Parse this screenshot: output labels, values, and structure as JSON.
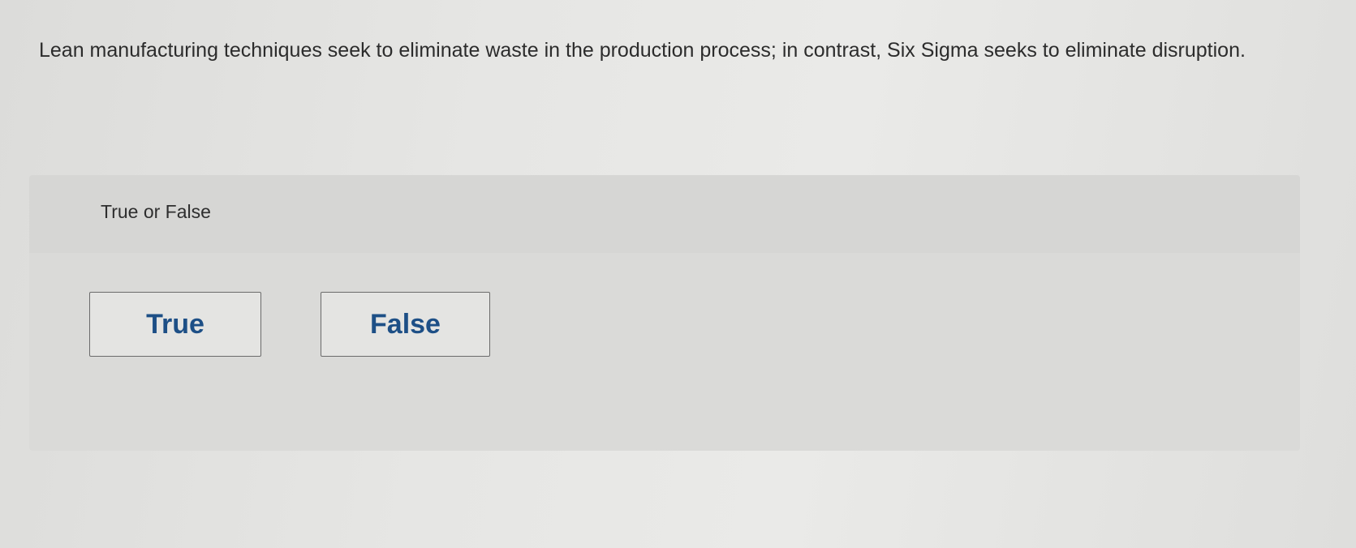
{
  "question": {
    "text": "Lean manufacturing techniques seek to eliminate waste in the production process; in contrast, Six Sigma seeks to eliminate disruption."
  },
  "answer_panel": {
    "type_label": "True or False",
    "choices": [
      {
        "label": "True"
      },
      {
        "label": "False"
      }
    ]
  },
  "colors": {
    "choice_text": "#1d4f86",
    "panel_background": "#dadad8",
    "page_background": "#e6e6e4"
  }
}
